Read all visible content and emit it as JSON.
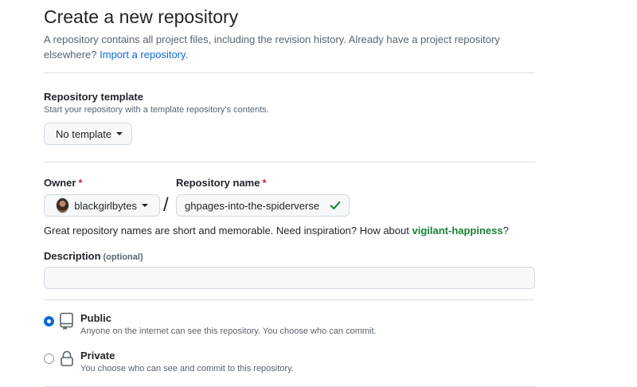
{
  "header": {
    "title": "Create a new repository",
    "subtitle_text": "A repository contains all project files, including the revision history. Already have a project repository elsewhere?",
    "import_link": "Import a repository.",
    "import_link_color": "#0969da"
  },
  "template": {
    "label": "Repository template",
    "hint": "Start your repository with a template repository's contents.",
    "button_label": "No template"
  },
  "owner": {
    "label": "Owner",
    "required_mark": "*",
    "selected": "blackgirlbytes"
  },
  "separator": "/",
  "repo_name": {
    "label": "Repository name",
    "required_mark": "*",
    "value": "ghpages-into-the-spiderverse",
    "valid_icon": "check-icon",
    "valid_color": "#1a7f37"
  },
  "name_helper": {
    "text": "Great repository names are short and memorable. Need inspiration? How about",
    "suggestion": "vigilant-happiness",
    "suffix": "?"
  },
  "description": {
    "label": "Description",
    "optional_tag": "(optional)",
    "value": "",
    "placeholder": ""
  },
  "visibility": {
    "options": [
      {
        "title": "Public",
        "desc": "Anyone on the internet can see this repository. You choose who can commit.",
        "icon": "repo-icon",
        "selected": true
      },
      {
        "title": "Private",
        "desc": "You choose who can see and commit to this repository.",
        "icon": "lock-icon",
        "selected": false
      }
    ]
  }
}
